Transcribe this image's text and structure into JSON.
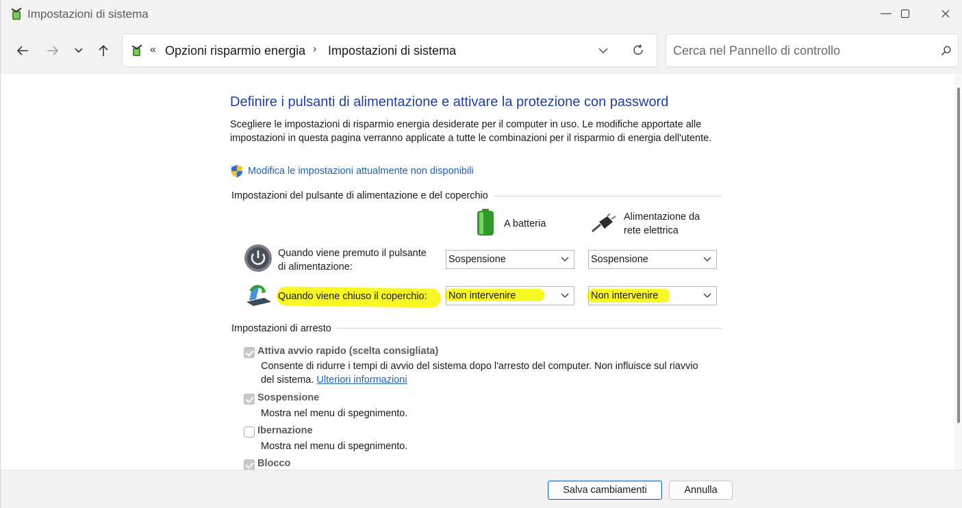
{
  "window": {
    "title": "Impostazioni di sistema",
    "minimize_icon": "minimize-icon",
    "maximize_icon": "maximize-icon",
    "close_icon": "close-icon"
  },
  "nav": {
    "breadcrumb_prefix": "«",
    "breadcrumb": [
      "Opzioni risparmio energia",
      "Impostazioni di sistema"
    ],
    "breadcrumb_separator": "›",
    "search_placeholder": "Cerca nel Pannello di controllo"
  },
  "page": {
    "heading": "Definire i pulsanti di alimentazione e attivare la protezione con password",
    "description": "Scegliere le impostazioni di risparmio energia desiderate per il computer in uso. Le modifiche apportate alle impostazioni in questa pagina verranno applicate a tutte le combinazioni per il risparmio di energia dell'utente.",
    "admin_link": "Modifica le impostazioni attualmente non disponibili"
  },
  "power_buttons": {
    "group_label": "Impostazioni del pulsante di alimentazione e del coperchio",
    "columns": {
      "battery": "A batteria",
      "plugged_line1": "Alimentazione da",
      "plugged_line2": "rete elettrica"
    },
    "rows": [
      {
        "label_line1": "Quando viene premuto il pulsante",
        "label_line2": "di alimentazione:",
        "battery": "Sospensione",
        "plugged": "Sospensione"
      },
      {
        "label": "Quando viene chiuso il coperchio:",
        "battery": "Non intervenire",
        "plugged": "Non intervenire"
      }
    ]
  },
  "shutdown": {
    "group_label": "Impostazioni di arresto",
    "items": [
      {
        "label": "Attiva avvio rapido (scelta consigliata)",
        "checked": true,
        "desc_line1": "Consente di ridurre i tempi di avvio del sistema dopo l'arresto del computer. Non influisce sul riavvio",
        "desc_line2_prefix": "del sistema.",
        "desc_link": "Ulteriori informazioni"
      },
      {
        "label": "Sospensione",
        "checked": true,
        "desc": "Mostra nel menu di spegnimento."
      },
      {
        "label": "Ibernazione",
        "checked": false,
        "desc": "Mostra nel menu di spegnimento."
      },
      {
        "label": "Blocco",
        "checked": true
      }
    ]
  },
  "footer": {
    "save": "Salva cambiamenti",
    "cancel": "Annulla"
  },
  "colors": {
    "heading": "#1f3f9f",
    "link": "#1f62b0",
    "highlight": "#f9f51a",
    "chrome": "#f3f3f3"
  }
}
